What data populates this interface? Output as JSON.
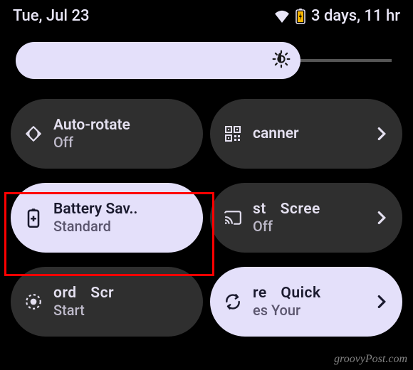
{
  "status": {
    "date": "Tue, Jul 23",
    "battery_text": "3 days, 11 hr"
  },
  "tiles": {
    "auto_rotate": {
      "title": "Auto-rotate",
      "subtitle": "Off"
    },
    "scanner": {
      "title": "canner",
      "subtitle": ""
    },
    "battery_saver": {
      "title": "Battery Sav..",
      "subtitle": "Standard"
    },
    "cast_screen": {
      "title": "st    Scree",
      "subtitle": "Off"
    },
    "record_screen": {
      "title": "ord    Scr",
      "subtitle": "Start"
    },
    "quick_share": {
      "title": "re    Quick",
      "subtitle": "es    Your"
    }
  },
  "watermark": "groovyPost.com"
}
